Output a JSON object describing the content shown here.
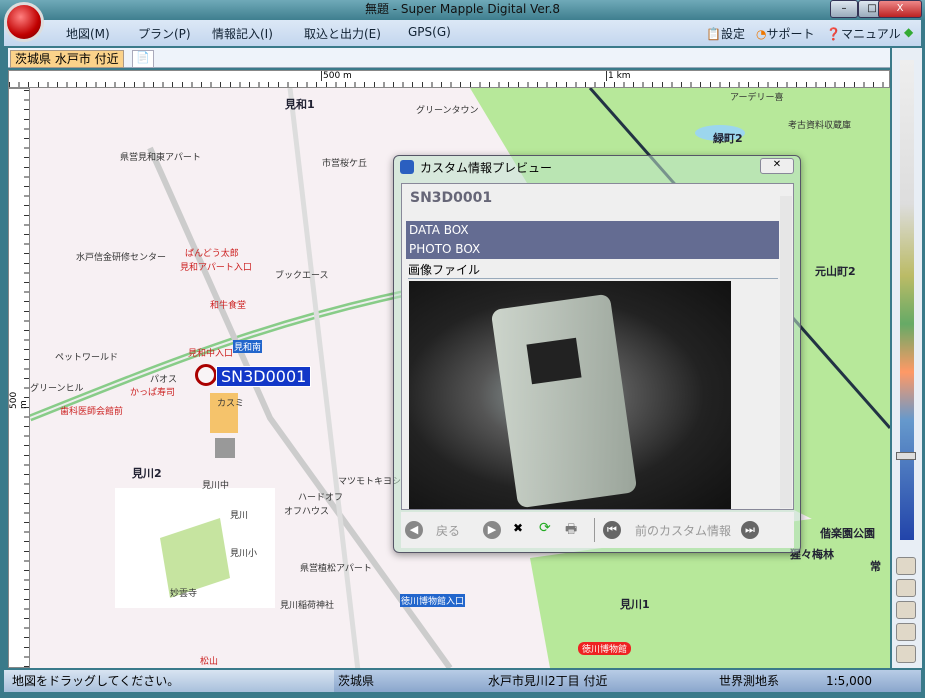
{
  "window": {
    "title": "無題 - Super Mapple Digital Ver.8",
    "min": "–",
    "max": "□",
    "close": "X"
  },
  "menu": [
    "地図(M)",
    "プラン(P)",
    "情報記入(I)",
    "取込と出力(E)",
    "GPS(G)"
  ],
  "toolbar_right": {
    "settings": "設定",
    "support": "サポート",
    "manual": "マニュアル"
  },
  "tabs": {
    "active": "茨城県 水戸市 付近",
    "new_icon": "new-tab-icon"
  },
  "ruler": {
    "mark1": "500 m",
    "mark2": "1 km",
    "vmark": "500 m"
  },
  "map": {
    "labels": [
      "見和1",
      "緑町2",
      "元山町2",
      "見川2",
      "見川1",
      "偕楽園公園",
      "猩々梅林",
      "常",
      "グリーンタウン",
      "アーデリー喜",
      "考古資料収蔵庫",
      "県営見和東アパート",
      "水戸信金研修センター",
      "ばんどう太郎",
      "見和アパート入口",
      "和牛食堂",
      "ブックエース",
      "ペットワールド",
      "グリーンヒル",
      "かっぱ寿司",
      "パオス",
      "カスミ",
      "見和中入口",
      "見和南",
      "見川中",
      "見川",
      "見川小",
      "ハードオフ",
      "オフハウス",
      "マツモトキヨシ",
      "県営植松アパート",
      "見川稲荷神社",
      "徳川博物館入口",
      "徳川博物館",
      "妙雲寺",
      "松山",
      "市営桜ケ丘",
      "歯科医師会館前"
    ],
    "marker": "SN3D0001"
  },
  "dialog": {
    "title": "カスタム情報プレビュー",
    "close": "✕",
    "heading": "SN3D0001",
    "rows": [
      "DATA BOX",
      "PHOTO BOX"
    ],
    "section": "画像ファイル",
    "footer": {
      "back": "戻る",
      "prev_custom": "前のカスタム情報"
    }
  },
  "status": {
    "hint": "地図をドラッグしてください。",
    "pref": "茨城県",
    "address": "水戸市見川2丁目 付近",
    "datum": "世界測地系",
    "scale": "1:5,000"
  }
}
